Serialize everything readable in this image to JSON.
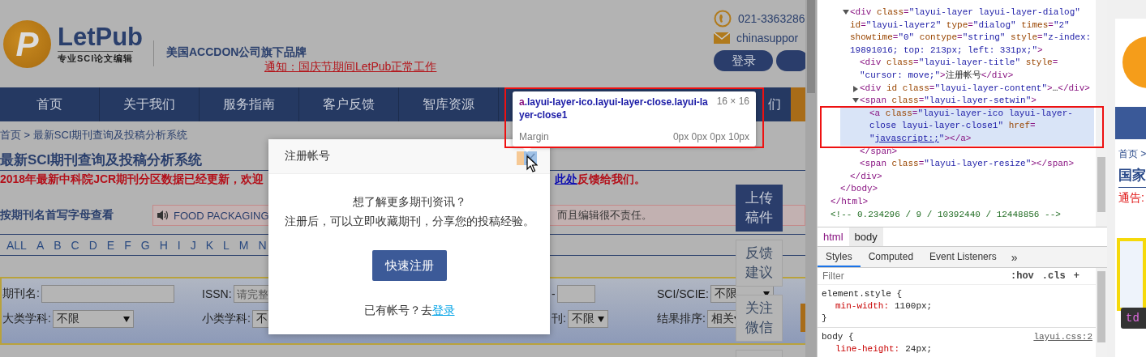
{
  "page": {
    "logo": {
      "letter": "P",
      "name": "LetPub",
      "tagline": "专业SCI论文编辑"
    },
    "slogan": "美国ACCDON公司旗下品牌",
    "notice_link": "通知：国庆节期间LetPub正常工作",
    "phone": "021-3363286",
    "email": "chinasuppor",
    "login_button": "登录",
    "nav": [
      {
        "label": "首页"
      },
      {
        "label": "关于我们"
      },
      {
        "label": "服务指南"
      },
      {
        "label": "客户反馈"
      },
      {
        "label": "智库资源"
      }
    ],
    "nav_trailing": "们",
    "breadcrumb": "首页 > 最新SCI期刊查询及投稿分析系统",
    "title": "最新SCI期刊查询及投稿分析系统",
    "announcement": {
      "text": "2018年最新中科院JCR期刊分区数据已经更新，欢迎",
      "link": "此处",
      "tail": "反馈给我们。"
    },
    "letters_heading": "按期刊名首写字母查看",
    "ticker": {
      "start": "FOOD PACKAGING",
      "end": "而且编辑很不责任。"
    },
    "letters": [
      "ALL",
      "A",
      "B",
      "C",
      "D",
      "E",
      "F",
      "G",
      "H",
      "I",
      "J",
      "K",
      "L",
      "M",
      "N"
    ],
    "search_rows": [
      [
        {
          "kind": "input",
          "label": "期刊名:"
        },
        {
          "kind": "input",
          "label": "ISSN:",
          "placeholder": "请完整"
        },
        {
          "kind": "input",
          "label": "-"
        },
        {
          "kind": "select",
          "label": "SCI/SCIE:",
          "value": "不限"
        }
      ],
      [
        {
          "kind": "select",
          "label": "大类学科:",
          "value": "不限"
        },
        {
          "kind": "select",
          "label": "小类学科:",
          "value": "不"
        },
        {
          "kind": "select",
          "label": "刊:",
          "value": "不限"
        },
        {
          "kind": "select",
          "label": "结果排序:",
          "value": "相关"
        }
      ]
    ]
  },
  "side_buttons": [
    {
      "kind": "primary",
      "label": "上传稿件"
    },
    {
      "kind": "plain",
      "label": "反馈建议"
    },
    {
      "kind": "plain",
      "label": "关注微信"
    },
    {
      "kind": "plain"
    }
  ],
  "dialog": {
    "title": "注册帐号",
    "lines": [
      "想了解更多期刊资讯？",
      "注册后，可以立即收藏期刊，分享您的投稿经验。"
    ],
    "button": "快速注册",
    "footer": {
      "text": "已有帐号？去",
      "link": "登录"
    }
  },
  "inspect_tooltip": {
    "selector_tag": "a",
    "selector_classes": ".layui-layer-ico.layui-layer-close.layui-layer-close1",
    "size": "16 × 16",
    "box_label": "Margin",
    "box_value": "0px 0px 0px 10px"
  },
  "devtools": {
    "dom_tree": [
      {
        "selected": false,
        "close": [
          {
            "kind": "tag",
            "text": "</html>"
          }
        ],
        "children": [
          {
            "selected": false,
            "close": [
              {
                "kind": "tag",
                "text": "</body>"
              }
            ],
            "children": [
              {
                "expanded": true,
                "selected": false,
                "lines": [
                  [
                    {
                      "kind": "tag",
                      "text": "<div"
                    },
                    {
                      "kind": "attr",
                      "text": " class"
                    },
                    {
                      "kind": "tag",
                      "text": "="
                    },
                    {
                      "kind": "value",
                      "text": "\"layui-layer layui-layer-dialog\""
                    }
                  ],
                  [
                    {
                      "kind": "attr",
                      "text": "id"
                    },
                    {
                      "kind": "tag",
                      "text": "="
                    },
                    {
                      "kind": "value",
                      "text": "\"layui-layer2\""
                    },
                    {
                      "kind": "attr",
                      "text": " type"
                    },
                    {
                      "kind": "tag",
                      "text": "="
                    },
                    {
                      "kind": "value",
                      "text": "\"dialog\""
                    },
                    {
                      "kind": "attr",
                      "text": " times"
                    },
                    {
                      "kind": "tag",
                      "text": "="
                    },
                    {
                      "kind": "value",
                      "text": "\"2\""
                    }
                  ],
                  [
                    {
                      "kind": "attr",
                      "text": "showtime"
                    },
                    {
                      "kind": "tag",
                      "text": "="
                    },
                    {
                      "kind": "value",
                      "text": "\"0\""
                    },
                    {
                      "kind": "attr",
                      "text": " contype"
                    },
                    {
                      "kind": "tag",
                      "text": "="
                    },
                    {
                      "kind": "value",
                      "text": "\"string\""
                    },
                    {
                      "kind": "attr",
                      "text": " style"
                    },
                    {
                      "kind": "tag",
                      "text": "="
                    },
                    {
                      "kind": "value",
                      "text": "\"z-index:"
                    }
                  ],
                  [
                    {
                      "kind": "value",
                      "text": "19891016; top: 213px; left: 331px;\""
                    },
                    {
                      "kind": "tag",
                      "text": ">"
                    }
                  ]
                ],
                "close": [
                  {
                    "kind": "tag",
                    "text": "</div>"
                  }
                ],
                "children": [
                  {
                    "selected": false,
                    "lines": [
                      [
                        {
                          "kind": "tag",
                          "text": "<div"
                        },
                        {
                          "kind": "attr",
                          "text": " class"
                        },
                        {
                          "kind": "tag",
                          "text": "="
                        },
                        {
                          "kind": "value",
                          "text": "\"layui-layer-title\""
                        },
                        {
                          "kind": "attr",
                          "text": " style"
                        },
                        {
                          "kind": "tag",
                          "text": "="
                        }
                      ],
                      [
                        {
                          "kind": "value",
                          "text": "\"cursor: move;\""
                        },
                        {
                          "kind": "tag",
                          "text": ">"
                        },
                        {
                          "kind": "text",
                          "text": "注册帐号"
                        },
                        {
                          "kind": "tag",
                          "text": "</div>"
                        }
                      ]
                    ]
                  },
                  {
                    "expanded": false,
                    "selected": false,
                    "lines": [
                      [
                        {
                          "kind": "tag",
                          "text": "<div"
                        },
                        {
                          "kind": "attr",
                          "text": " id class"
                        },
                        {
                          "kind": "tag",
                          "text": "="
                        },
                        {
                          "kind": "value",
                          "text": "\"layui-layer-content\""
                        },
                        {
                          "kind": "tag",
                          "text": ">"
                        },
                        {
                          "kind": "text",
                          "text": "…"
                        },
                        {
                          "kind": "tag",
                          "text": "</div>"
                        }
                      ]
                    ]
                  },
                  {
                    "expanded": true,
                    "selected": false,
                    "lines": [
                      [
                        {
                          "kind": "tag",
                          "text": "<span"
                        },
                        {
                          "kind": "attr",
                          "text": " class"
                        },
                        {
                          "kind": "tag",
                          "text": "="
                        },
                        {
                          "kind": "value",
                          "text": "\"layui-layer-setwin\""
                        },
                        {
                          "kind": "tag",
                          "text": ">"
                        }
                      ]
                    ],
                    "close": [
                      {
                        "kind": "tag",
                        "text": "</span>"
                      }
                    ],
                    "children": [
                      {
                        "selected": true,
                        "lines": [
                          [
                            {
                              "kind": "tag",
                              "text": "<a"
                            },
                            {
                              "kind": "attr",
                              "text": " class"
                            },
                            {
                              "kind": "tag",
                              "text": "="
                            },
                            {
                              "kind": "value",
                              "text": "\"layui-layer-ico layui-layer-"
                            }
                          ],
                          [
                            {
                              "kind": "value",
                              "text": "close layui-layer-close1\""
                            },
                            {
                              "kind": "attr",
                              "text": " href"
                            },
                            {
                              "kind": "tag",
                              "text": "="
                            }
                          ],
                          [
                            {
                              "kind": "value",
                              "text": "\""
                            },
                            {
                              "kind": "link",
                              "text": "javascript:;"
                            },
                            {
                              "kind": "value",
                              "text": "\""
                            },
                            {
                              "kind": "tag",
                              "text": "></a>"
                            }
                          ]
                        ]
                      }
                    ]
                  },
                  {
                    "selected": false,
                    "lines": [
                      [
                        {
                          "kind": "tag",
                          "text": "<span"
                        },
                        {
                          "kind": "attr",
                          "text": " class"
                        },
                        {
                          "kind": "tag",
                          "text": "="
                        },
                        {
                          "kind": "value",
                          "text": "\"layui-layer-resize\""
                        },
                        {
                          "kind": "tag",
                          "text": "></span>"
                        }
                      ]
                    ]
                  }
                ]
              }
            ]
          }
        ]
      },
      {
        "selected": false,
        "lines": [
          [
            {
              "kind": "comment",
              "text": "<!-- 0.234296 / 9 / 10392440 / 12448856 -->"
            }
          ]
        ]
      }
    ],
    "crumbs": [
      {
        "label": "html",
        "selected": false
      },
      {
        "label": "body",
        "selected": true
      }
    ],
    "tabs": [
      {
        "label": "Styles",
        "selected": true
      },
      {
        "label": "Computed",
        "selected": false
      },
      {
        "label": "Event Listeners",
        "selected": false
      }
    ],
    "more_tabs": "»",
    "filter_placeholder": "Filter",
    "filter_tools": [
      ":hov",
      ".cls",
      "+"
    ],
    "rules": [
      {
        "selector": "element.style {",
        "declarations": [
          {
            "property": "min-width:",
            "value": "1100px;"
          }
        ],
        "close": "}"
      },
      {
        "selector": "body {",
        "source": "layui.css:2",
        "declarations": [
          {
            "property": "line-height:",
            "value": "24px;"
          }
        ]
      }
    ]
  },
  "preview": {
    "breadcrumb": "首页 >",
    "heading": "国家",
    "notice": "通告:",
    "hover_tag": "td"
  }
}
